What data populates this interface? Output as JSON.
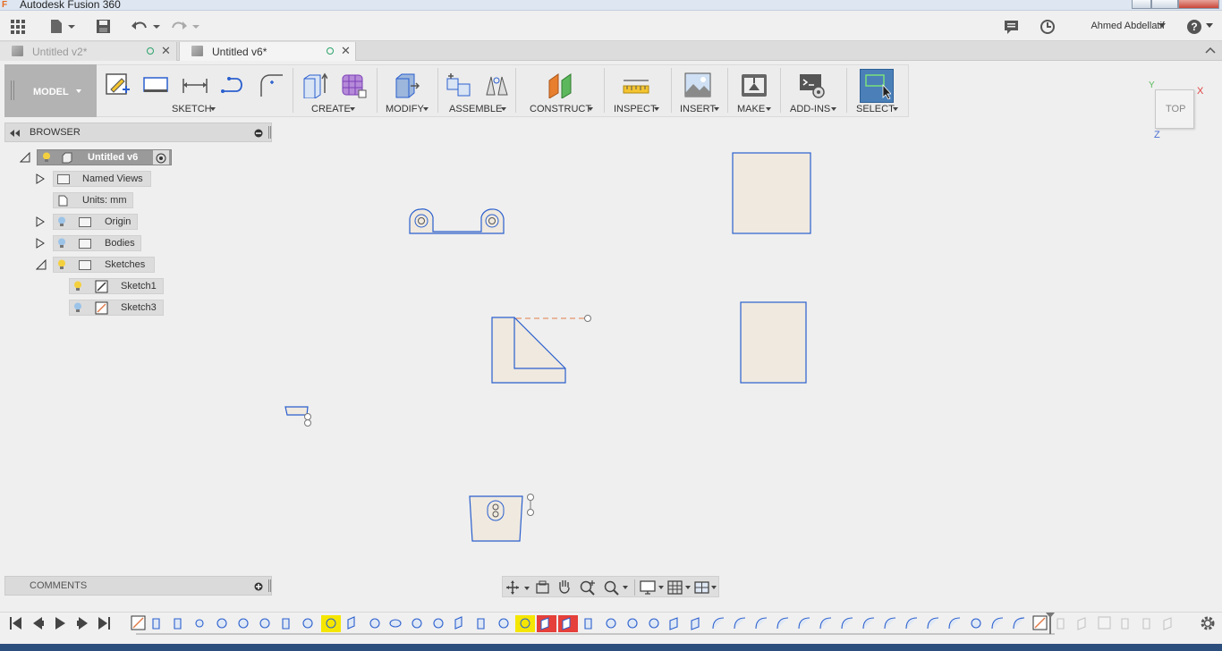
{
  "window": {
    "title": "Autodesk Fusion 360"
  },
  "appbar": {
    "user_name": "Ahmed Abdellatif",
    "help_label": "?"
  },
  "tabs": [
    {
      "label": "Untitled v2*",
      "active": false
    },
    {
      "label": "Untitled v6*",
      "active": true
    }
  ],
  "ribbon": {
    "workspace": "MODEL",
    "groups": [
      "SKETCH",
      "CREATE",
      "MODIFY",
      "ASSEMBLE",
      "CONSTRUCT",
      "INSPECT",
      "INSERT",
      "MAKE",
      "ADD-INS",
      "SELECT"
    ]
  },
  "browser": {
    "header": "BROWSER",
    "root": "Untitled v6",
    "items": {
      "named_views": "Named Views",
      "units": "Units: mm",
      "origin": "Origin",
      "bodies": "Bodies",
      "sketches": "Sketches",
      "sketch1": "Sketch1",
      "sketch3": "Sketch3"
    }
  },
  "comments": {
    "header": "COMMENTS"
  },
  "viewcube": {
    "face": "TOP",
    "x_axis": "X",
    "y_axis": "Y",
    "z_axis": "Z"
  },
  "colors": {
    "accent": "#2a5fce",
    "body_fill": "#efe9df",
    "select_active": "#4a7fb8",
    "timeline_highlight_yellow": "#f5e600",
    "timeline_highlight_red": "#e5403a",
    "constraint_line": "#e07c4a"
  }
}
